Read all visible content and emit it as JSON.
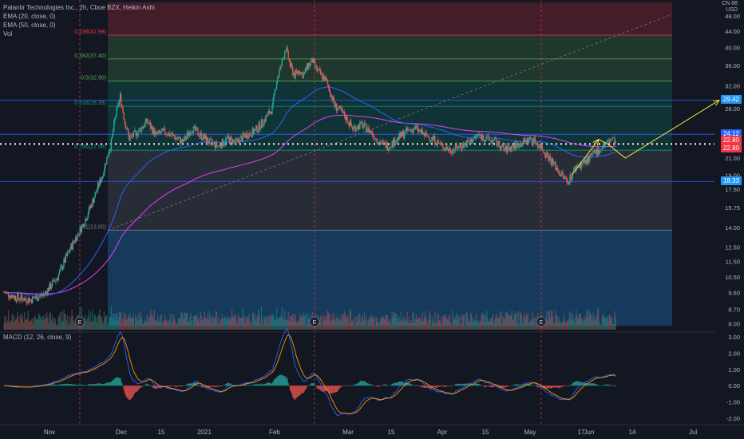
{
  "header": {
    "symbol": "Palantir Technologies Inc.",
    "interval": "2h",
    "exchange": "Cboe BZX",
    "chart_style": "Heikin Ashi",
    "title": "Palantir Technologies Inc., 2h, Cboe BZX, Heikin Ashi",
    "currency_top": "CN 88",
    "currency": "USD"
  },
  "indicators": [
    {
      "label": "EMA (20, close, 0)",
      "color": "#2962ff"
    },
    {
      "label": "EMA (50, close, 0)",
      "color": "#e040fb"
    },
    {
      "label": "Vol",
      "color": "#b2b5be"
    }
  ],
  "macd_label": "MACD (12, 26, close, 9)",
  "colors": {
    "background": "#131722",
    "up": "#26a69a",
    "down": "#ef5350",
    "ema20": "#2962ff",
    "ema50": "#e040fb",
    "fib_red": "#f23645",
    "fib_green": "#4caf50",
    "fib_teal": "#089981",
    "fib_blue": "#2196f3",
    "projection": "#ffeb3b",
    "dotted_price": "#ffffff"
  },
  "chart_data": [
    {
      "type": "candlestick",
      "scale": "log",
      "ylim": [
        7.8,
        52
      ],
      "x_ticks": [
        "Nov",
        "Dec",
        "15",
        "2021",
        "Feb",
        "Mar",
        "15",
        "Apr",
        "15",
        "May",
        "17",
        "Jun",
        "14",
        "Jul"
      ],
      "y_ticks": [
        "48.00",
        "44.00",
        "40.00",
        "36.00",
        "32.00",
        "28.00",
        "24.00",
        "21.00",
        "19.00",
        "17.50",
        "15.75",
        "14.00",
        "12.50",
        "11.50",
        "10.50",
        "9.60",
        "8.70",
        "8.00"
      ],
      "fib_levels": [
        {
          "ratio": "0.236",
          "price": 42.98,
          "label": "0.236(42.98)"
        },
        {
          "ratio": "0.382",
          "price": 37.4,
          "label": "0.382(37.40)"
        },
        {
          "ratio": "0.5",
          "price": 32.9,
          "label": "0.5(32.90)"
        },
        {
          "ratio": "0.618",
          "price": 28.39,
          "label": "0.618(28.39)"
        },
        {
          "ratio": "0.786",
          "price": 21.98,
          "label": "0.786(21.98)"
        },
        {
          "ratio": "1",
          "price": 13.8,
          "label": "1(13.80)"
        }
      ],
      "horizontal_levels": [
        29.42,
        24.12,
        18.33
      ],
      "price_labels": [
        {
          "value": "29.42",
          "color": "#2196f3"
        },
        {
          "value": "24.12",
          "color": "#2962ff"
        },
        {
          "value": "22.80",
          "color": "#f23645"
        },
        {
          "value": "22.80",
          "color": "#f23645"
        },
        {
          "value": "18.33",
          "color": "#2196f3"
        }
      ],
      "current_price": 22.8,
      "earnings_markers": [
        "E",
        "E",
        "E"
      ],
      "price_path": [
        [
          0,
          9.6
        ],
        [
          3,
          9.3
        ],
        [
          6,
          9.2
        ],
        [
          9,
          9.5
        ],
        [
          12,
          10.5
        ],
        [
          15,
          12.5
        ],
        [
          18,
          14.5
        ],
        [
          20,
          16.5
        ],
        [
          22,
          19
        ],
        [
          24,
          23
        ],
        [
          25,
          27
        ],
        [
          26,
          30
        ],
        [
          27,
          26
        ],
        [
          28,
          23.5
        ],
        [
          30,
          24.5
        ],
        [
          32,
          26
        ],
        [
          34,
          24
        ],
        [
          36,
          24.5
        ],
        [
          38,
          23.8
        ],
        [
          40,
          23
        ],
        [
          42,
          25
        ],
        [
          44,
          24
        ],
        [
          46,
          23
        ],
        [
          48,
          22.5
        ],
        [
          50,
          23.5
        ],
        [
          52,
          23
        ],
        [
          54,
          24
        ],
        [
          56,
          24.5
        ],
        [
          58,
          26
        ],
        [
          60,
          28
        ],
        [
          61,
          33
        ],
        [
          62,
          36
        ],
        [
          63,
          40
        ],
        [
          64,
          36
        ],
        [
          65,
          34
        ],
        [
          66,
          35
        ],
        [
          67,
          34
        ],
        [
          68,
          36
        ],
        [
          69,
          37
        ],
        [
          70,
          35
        ],
        [
          72,
          33
        ],
        [
          74,
          28.5
        ],
        [
          76,
          27
        ],
        [
          78,
          25
        ],
        [
          80,
          25.5
        ],
        [
          82,
          24.5
        ],
        [
          84,
          23
        ],
        [
          86,
          22.5
        ],
        [
          88,
          23.5
        ],
        [
          90,
          24.5
        ],
        [
          92,
          25
        ],
        [
          94,
          24
        ],
        [
          96,
          23.5
        ],
        [
          98,
          22.5
        ],
        [
          100,
          22
        ],
        [
          102,
          22.5
        ],
        [
          104,
          23
        ],
        [
          106,
          24
        ],
        [
          108,
          23.5
        ],
        [
          110,
          23
        ],
        [
          112,
          22
        ],
        [
          114,
          22.5
        ],
        [
          116,
          23
        ],
        [
          118,
          23.5
        ],
        [
          120,
          22.5
        ],
        [
          122,
          21
        ],
        [
          124,
          19.5
        ],
        [
          126,
          18.3
        ],
        [
          127,
          19
        ],
        [
          128,
          20
        ],
        [
          130,
          20.5
        ],
        [
          132,
          21.5
        ],
        [
          134,
          22.5
        ],
        [
          136,
          23.5
        ],
        [
          137,
          22.8
        ]
      ],
      "projection_path": [
        [
          127,
          19
        ],
        [
          133,
          23.4
        ],
        [
          135,
          22.8
        ],
        [
          139,
          21.0
        ],
        [
          160,
          29.42
        ]
      ]
    },
    {
      "type": "line",
      "name": "MACD",
      "ylim": [
        -2.3,
        3.2
      ],
      "y_ticks": [
        "3.00",
        "2.00",
        "1.00",
        "0.00",
        "-1.00",
        "-2.00"
      ]
    }
  ]
}
